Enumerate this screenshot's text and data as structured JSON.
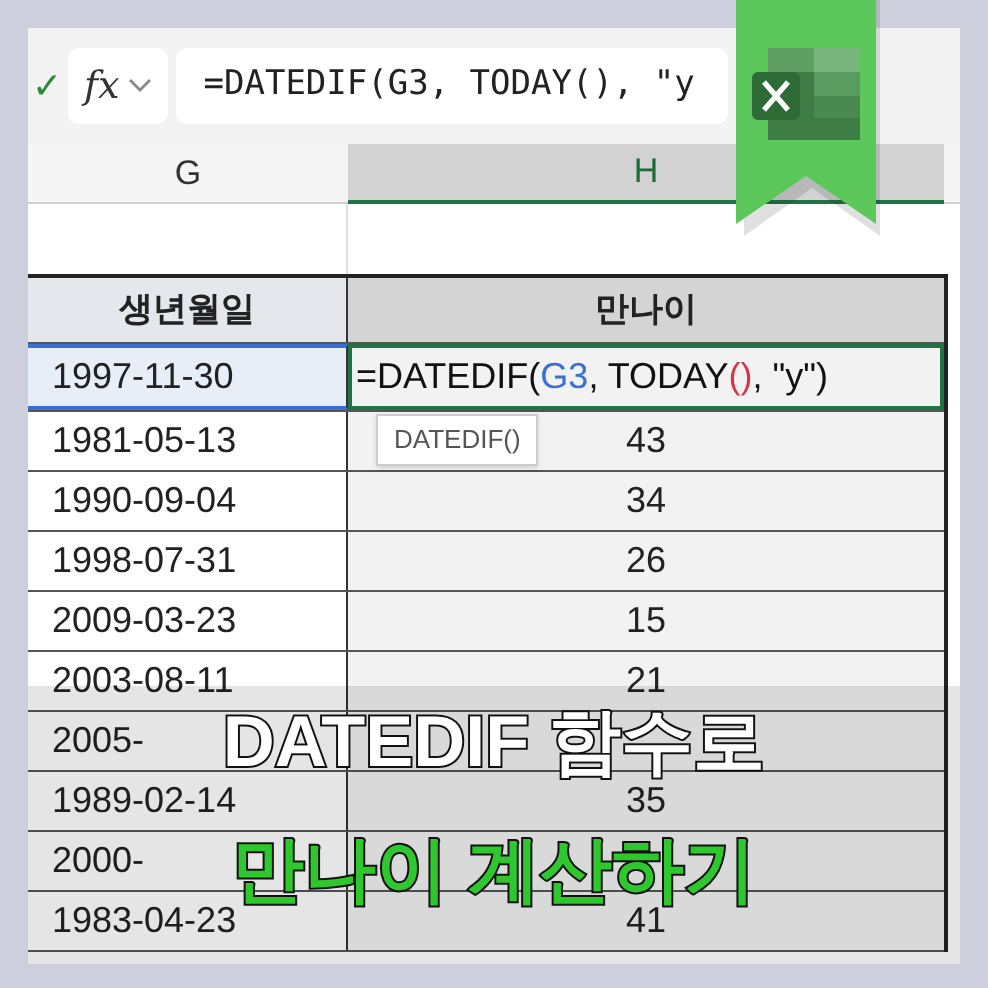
{
  "formula_bar": {
    "enter_mark": "✓",
    "function_label": "fx",
    "formula": "=DATEDIF(G3, TODAY(), \"y"
  },
  "columns": [
    {
      "label": "G",
      "selected": false
    },
    {
      "label": "H",
      "selected": true
    }
  ],
  "table": {
    "headers": [
      "생년월일",
      "만나이"
    ],
    "active_row": {
      "date": "1997-11-30",
      "formula_segments": [
        {
          "text": "=DATEDIF(",
          "color": "#111111"
        },
        {
          "text": "G3",
          "color": "#3b6fd8"
        },
        {
          "text": ", TODAY",
          "color": "#111111"
        },
        {
          "text": "()",
          "color": "#d0394a"
        },
        {
          "text": ", \"y\")",
          "color": "#111111"
        }
      ]
    },
    "tooltip": "DATEDIF()",
    "rows": [
      {
        "date": "1981-05-13",
        "age": "43"
      },
      {
        "date": "1990-09-04",
        "age": "34"
      },
      {
        "date": "1998-07-31",
        "age": "26"
      },
      {
        "date": "2009-03-23",
        "age": "15"
      },
      {
        "date": "2003-08-11",
        "age": "21"
      },
      {
        "date": "2005-",
        "age": ""
      },
      {
        "date": "1989-02-14",
        "age": "35"
      },
      {
        "date": "2000-",
        "age": ""
      },
      {
        "date": "1983-04-23",
        "age": "41"
      }
    ]
  },
  "title": {
    "line_1": "DATEDIF 함수로",
    "line_2": "만나이 계산하기"
  }
}
